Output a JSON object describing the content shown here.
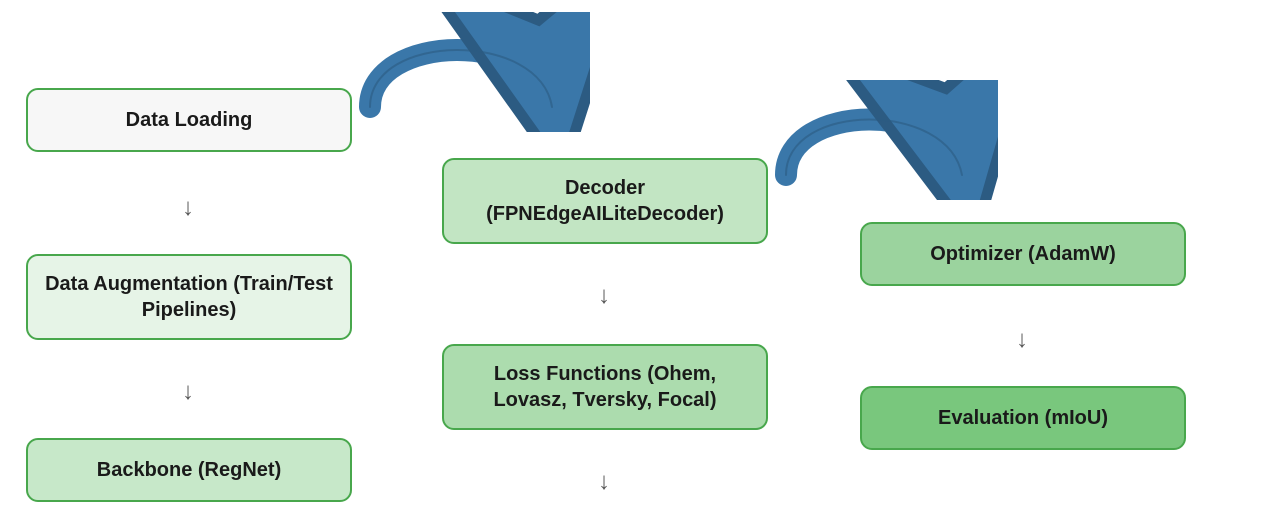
{
  "colors": {
    "border": "#48a74c",
    "arrow_fill": "#3a77a9",
    "arrow_stroke": "#2c5b82",
    "n1_bg": "#f7f7f7",
    "n2_bg": "#e6f4e7",
    "n3_bg": "#c7e8c9",
    "n4_bg": "#c2e5c3",
    "n5_bg": "#acdcae",
    "n6_bg": "#9bd39e",
    "n7_bg": "#79c77d"
  },
  "nodes": {
    "n1": "Data Loading",
    "n2": "Data Augmentation (Train/Test Pipelines)",
    "n3": "Backbone (RegNet)",
    "n4": "Decoder (FPNEdgeAILiteDecoder)",
    "n5": "Loss Functions (Ohem, Lovasz, Tversky, Focal)",
    "n6": "Optimizer (AdamW)",
    "n7": "Evaluation (mIoU)"
  },
  "glyphs": {
    "down": "↓"
  }
}
